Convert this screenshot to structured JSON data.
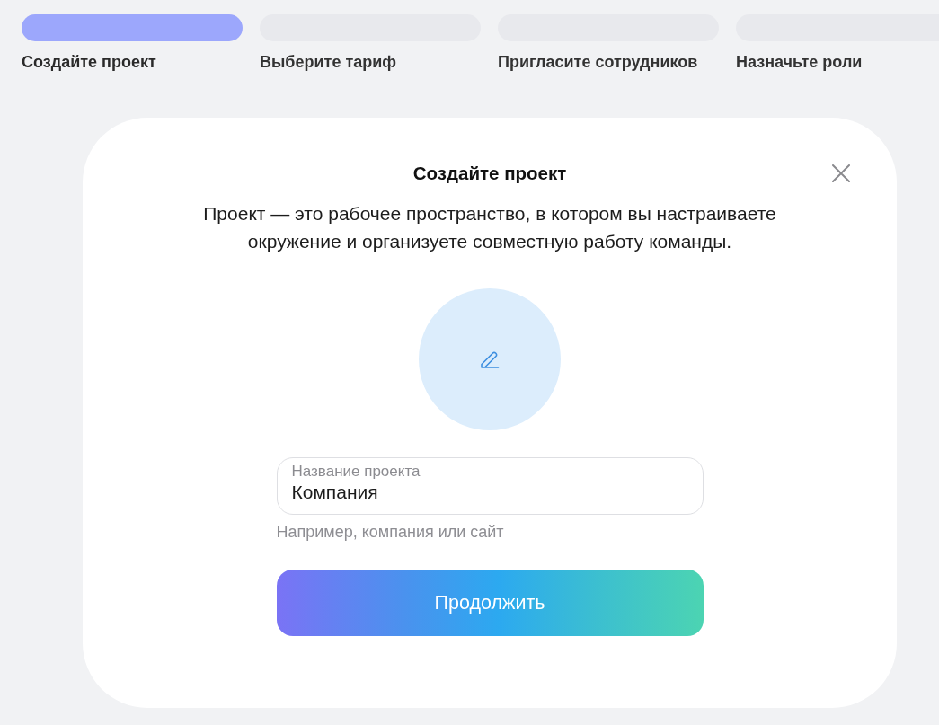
{
  "steps": [
    {
      "label": "Создайте проект",
      "selected": true
    },
    {
      "label": "Выберите тариф",
      "selected": false
    },
    {
      "label": "Пригласите сотрудников",
      "selected": false
    },
    {
      "label": "Назначьте роли",
      "selected": false
    }
  ],
  "dialog": {
    "title": "Создайте проект",
    "description": "Проект — это рабочее пространство, в котором вы настраиваете окружение и организуете совместную работу команды.",
    "project_name_field": {
      "label": "Название проекта",
      "value": "Компания",
      "hint": "Например, компания или сайт"
    },
    "continue_button": "Продолжить"
  }
}
